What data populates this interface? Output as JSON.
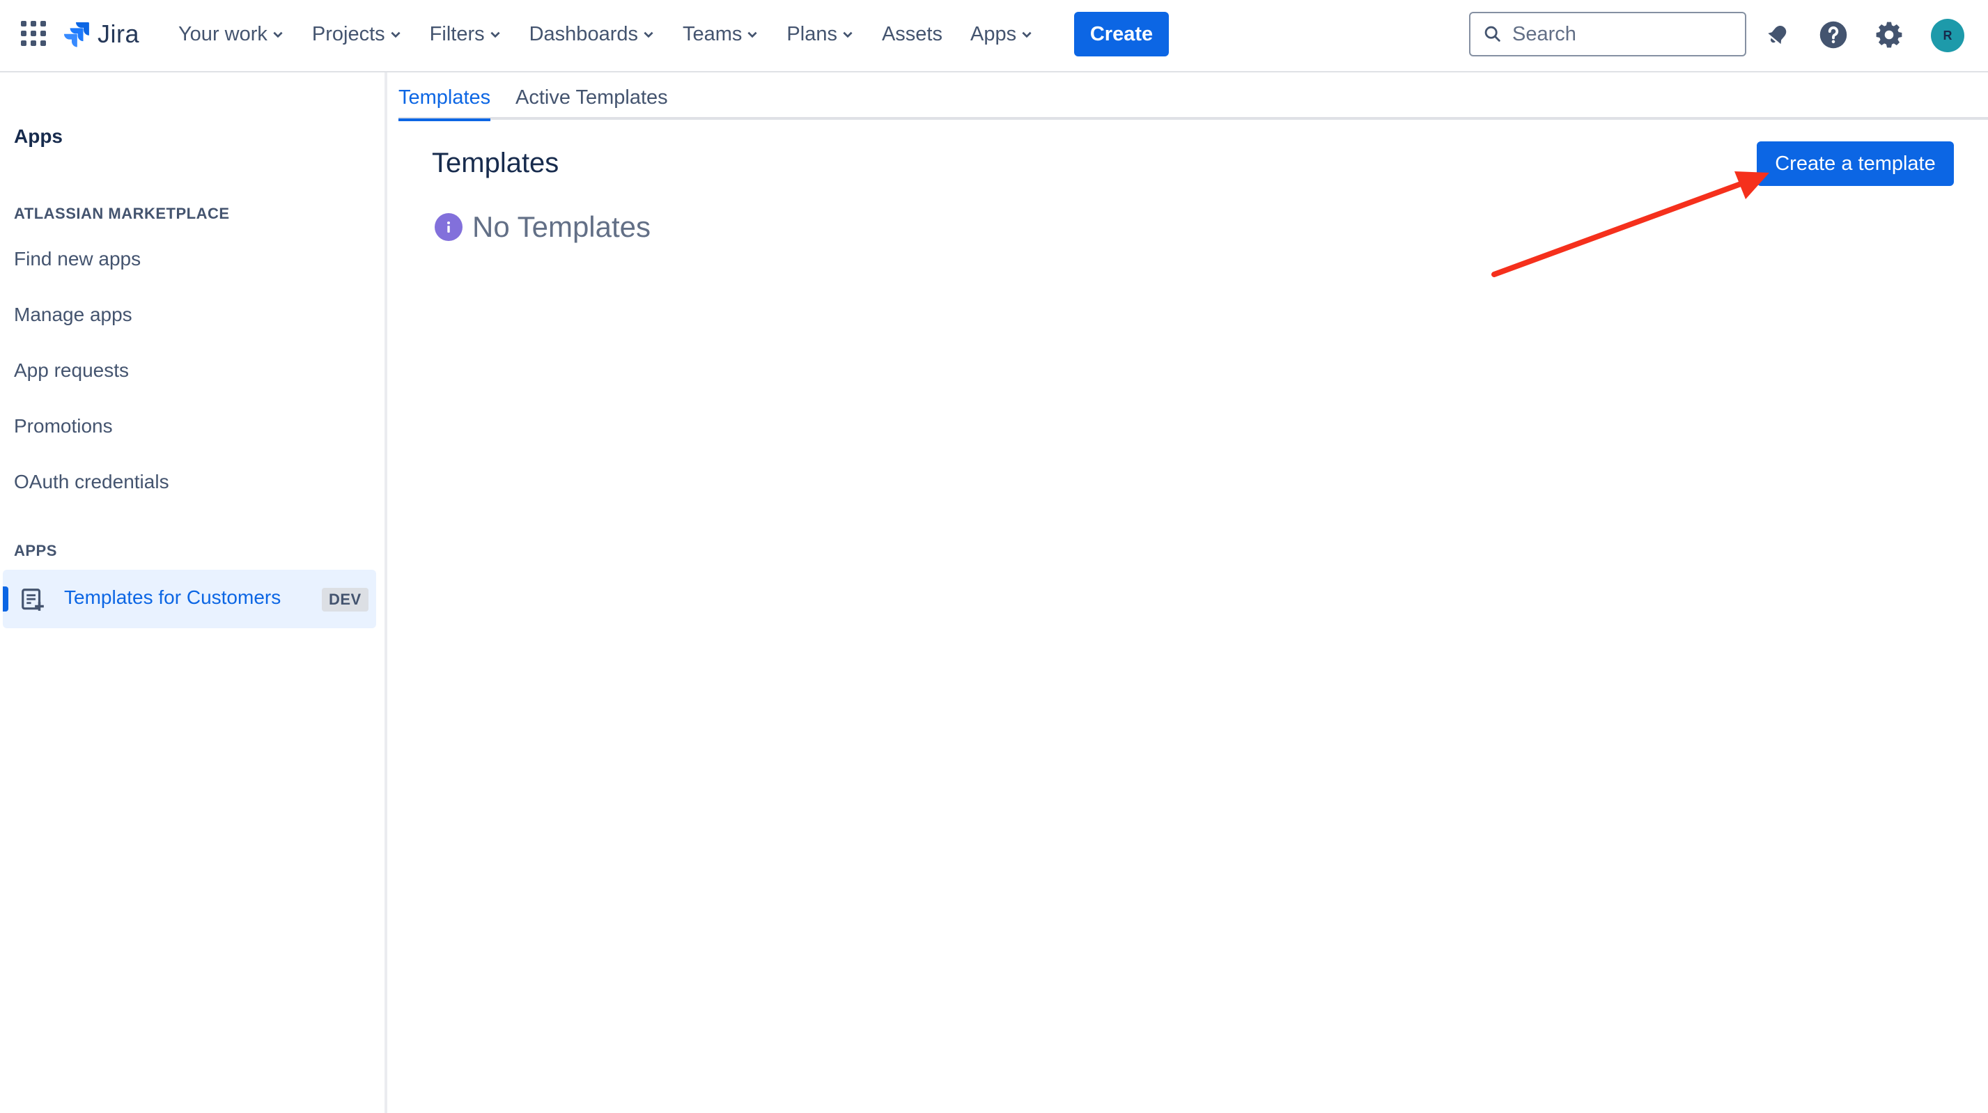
{
  "topnav": {
    "logo_text": "Jira",
    "items": [
      {
        "label": "Your work",
        "has_dropdown": true
      },
      {
        "label": "Projects",
        "has_dropdown": true
      },
      {
        "label": "Filters",
        "has_dropdown": true
      },
      {
        "label": "Dashboards",
        "has_dropdown": true
      },
      {
        "label": "Teams",
        "has_dropdown": true
      },
      {
        "label": "Plans",
        "has_dropdown": true
      },
      {
        "label": "Assets",
        "has_dropdown": false
      },
      {
        "label": "Apps",
        "has_dropdown": true
      }
    ],
    "create_label": "Create",
    "search_placeholder": "Search",
    "avatar_initial": "R",
    "icons": [
      "app-switcher-icon",
      "notifications-icon",
      "help-icon",
      "settings-icon"
    ]
  },
  "sidebar": {
    "title": "Apps",
    "section_marketplace": "ATLASSIAN MARKETPLACE",
    "marketplace_links": [
      "Find new apps",
      "Manage apps",
      "App requests",
      "Promotions",
      "OAuth credentials"
    ],
    "section_apps": "APPS",
    "selected_app": {
      "label": "Templates for Customers",
      "badge": "DEV"
    }
  },
  "main": {
    "tabs": [
      {
        "label": "Templates",
        "active": true
      },
      {
        "label": "Active Templates",
        "active": false
      }
    ],
    "title": "Templates",
    "create_button": "Create a template",
    "empty_state": "No Templates"
  },
  "colors": {
    "brand": "#0c66e4",
    "annotation_arrow": "#f5301c",
    "info_icon": "#8270db",
    "avatar": "#1d9aaa"
  }
}
